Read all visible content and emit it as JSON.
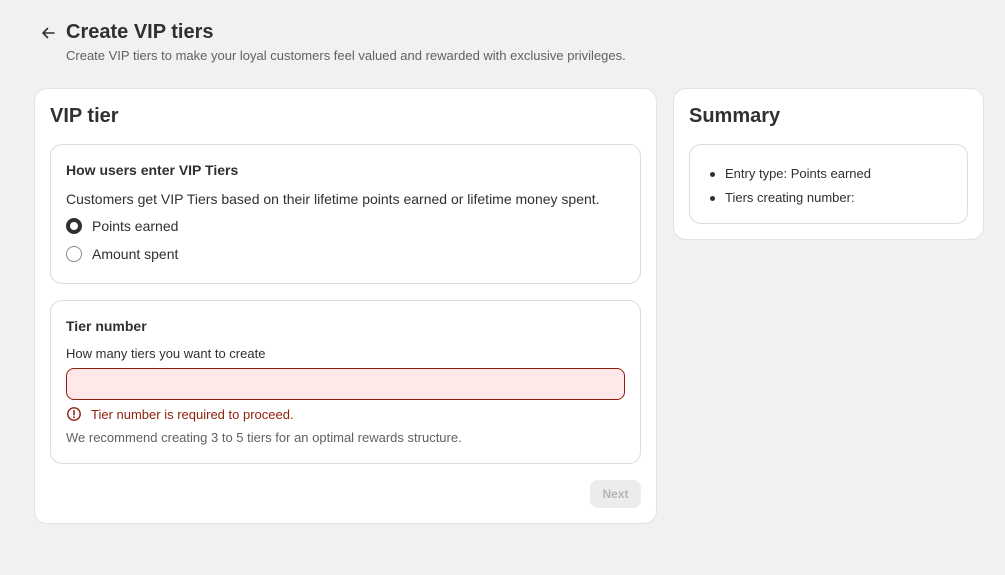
{
  "header": {
    "title": "Create VIP tiers",
    "subtitle": "Create VIP tiers to make your loyal customers feel valued and rewarded with exclusive privileges."
  },
  "vip_tier": {
    "title": "VIP tier",
    "entry_section": {
      "title": "How users enter VIP Tiers",
      "description": "Customers get VIP Tiers based on their lifetime points earned or lifetime money spent.",
      "options": [
        {
          "label": "Points earned",
          "selected": true
        },
        {
          "label": "Amount spent",
          "selected": false
        }
      ]
    },
    "tier_section": {
      "title": "Tier number",
      "field_label": "How many tiers you want to create",
      "input_value": "",
      "error_text": "Tier number is required to proceed.",
      "help_text": "We recommend creating 3 to 5 tiers for an optimal rewards structure."
    },
    "next_label": "Next"
  },
  "summary": {
    "title": "Summary",
    "items": [
      "Entry type: Points earned",
      "Tiers creating number:"
    ]
  },
  "colors": {
    "page_background": "#f1f1f1",
    "error": "#8e1f0b",
    "error_fill": "#fee9e8",
    "disabled_button": "#ececec"
  },
  "icons": {
    "back": "arrow-left-icon",
    "error": "alert-circle-icon"
  }
}
